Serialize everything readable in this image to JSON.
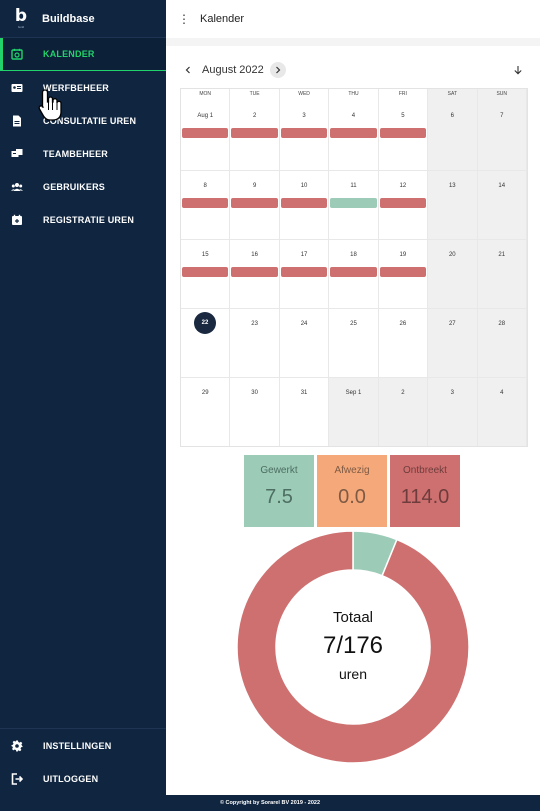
{
  "brand": {
    "logo_letter": "b",
    "logo_sub": "build",
    "name": "Buildbase"
  },
  "sidebar": {
    "items": [
      {
        "label": "KALENDER",
        "icon": "calendar-check-icon",
        "active": true
      },
      {
        "label": "WERFBEHEER",
        "icon": "id-card-icon",
        "active": false
      },
      {
        "label": "CONSULTATIE UREN",
        "icon": "document-icon",
        "active": false
      },
      {
        "label": "TEAMBEHEER",
        "icon": "team-card-icon",
        "active": false
      },
      {
        "label": "GEBRUIKERS",
        "icon": "users-icon",
        "active": false
      },
      {
        "label": "REGISTRATIE UREN",
        "icon": "calendar-add-icon",
        "active": false
      }
    ],
    "bottom": [
      {
        "label": "INSTELLINGEN",
        "icon": "gear-icon"
      },
      {
        "label": "UITLOGGEN",
        "icon": "logout-icon"
      }
    ]
  },
  "topbar": {
    "title": "Kalender"
  },
  "calendar": {
    "month_label": "August 2022",
    "weekdays": [
      "MON",
      "TUE",
      "WED",
      "THU",
      "FRI",
      "SAT",
      "SUN"
    ],
    "weeks": [
      [
        {
          "d": "Aug 1",
          "bar": "red"
        },
        {
          "d": "2",
          "bar": "red"
        },
        {
          "d": "3",
          "bar": "red"
        },
        {
          "d": "4",
          "bar": "red"
        },
        {
          "d": "5",
          "bar": "red"
        },
        {
          "d": "6",
          "we": true
        },
        {
          "d": "7",
          "we": true
        }
      ],
      [
        {
          "d": "8",
          "bar": "red"
        },
        {
          "d": "9",
          "bar": "red"
        },
        {
          "d": "10",
          "bar": "red"
        },
        {
          "d": "11",
          "bar": "green"
        },
        {
          "d": "12",
          "bar": "red"
        },
        {
          "d": "13",
          "we": true
        },
        {
          "d": "14",
          "we": true
        }
      ],
      [
        {
          "d": "15",
          "bar": "red"
        },
        {
          "d": "16",
          "bar": "red"
        },
        {
          "d": "17",
          "bar": "red"
        },
        {
          "d": "18",
          "bar": "red"
        },
        {
          "d": "19",
          "bar": "red"
        },
        {
          "d": "20",
          "we": true
        },
        {
          "d": "21",
          "we": true
        }
      ],
      [
        {
          "d": "22",
          "today": true
        },
        {
          "d": "23"
        },
        {
          "d": "24"
        },
        {
          "d": "25"
        },
        {
          "d": "26"
        },
        {
          "d": "27",
          "we": true
        },
        {
          "d": "28",
          "we": true
        }
      ],
      [
        {
          "d": "29"
        },
        {
          "d": "30"
        },
        {
          "d": "31"
        },
        {
          "d": "Sep 1",
          "other": true
        },
        {
          "d": "2",
          "other": true
        },
        {
          "d": "3",
          "we": true
        },
        {
          "d": "4",
          "we": true
        }
      ]
    ]
  },
  "stats": {
    "gewerkt": {
      "label": "Gewerkt",
      "value": "7.5"
    },
    "afwezig": {
      "label": "Afwezig",
      "value": "0.0"
    },
    "ontbreekt": {
      "label": "Ontbreekt",
      "value": "114.0"
    }
  },
  "donut": {
    "label": "Totaal",
    "value": "7/176",
    "unit": "uren",
    "segments": [
      {
        "name": "Gewerkt",
        "value": 7.5,
        "color": "#9ccbb8"
      },
      {
        "name": "Afwezig",
        "value": 0.0,
        "color": "#f5a97a"
      },
      {
        "name": "Ontbreekt",
        "value": 114.0,
        "color": "#cf7070"
      }
    ]
  },
  "colors": {
    "accent": "#22d36b",
    "sidebar": "#0f2540",
    "red": "#cf7070",
    "green": "#9ccbb8",
    "orange": "#f5a97a"
  },
  "footer": {
    "text": "© Copyright by Sorarel BV 2019 - 2022"
  }
}
